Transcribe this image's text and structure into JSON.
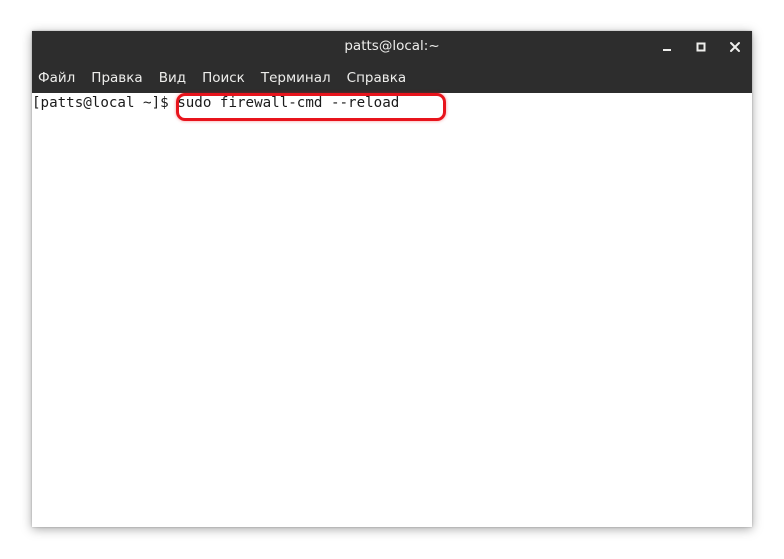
{
  "window": {
    "title": "patts@local:~",
    "controls": {
      "minimize_icon": "minimize-icon",
      "maximize_icon": "maximize-icon",
      "close_icon": "close-icon"
    }
  },
  "menubar": {
    "items": [
      "Файл",
      "Правка",
      "Вид",
      "Поиск",
      "Терминал",
      "Справка"
    ]
  },
  "terminal": {
    "prompt": "[patts@local ~]$",
    "command": " sudo firewall-cmd --reload"
  },
  "colors": {
    "titlebar_bg": "#2d2d2d",
    "titlebar_text": "#eeeeec",
    "terminal_bg": "#ffffff",
    "terminal_text": "#1a1a1a",
    "annotation_highlight": "#e8141c"
  }
}
